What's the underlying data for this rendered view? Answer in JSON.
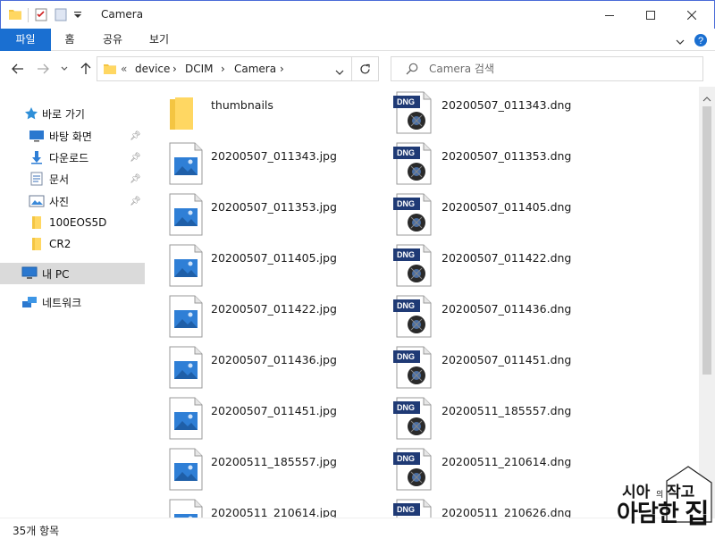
{
  "window": {
    "title": "Camera",
    "minimize_icon": "minimize-icon",
    "maximize_icon": "maximize-icon",
    "close_icon": "close-icon"
  },
  "ribbon": {
    "tabs": [
      {
        "label": "파일",
        "active": true
      },
      {
        "label": "홈"
      },
      {
        "label": "공유"
      },
      {
        "label": "보기"
      }
    ],
    "accent_color": "#1a6fd1"
  },
  "address": {
    "overflow": "«",
    "crumbs": [
      "device",
      "DCIM",
      "Camera"
    ]
  },
  "search": {
    "placeholder": "Camera 검색"
  },
  "sidebar": {
    "quick_access": "바로 가기",
    "items": [
      {
        "label": "바탕 화면",
        "icon": "desktop-icon",
        "pinned": true
      },
      {
        "label": "다운로드",
        "icon": "download-icon",
        "pinned": true
      },
      {
        "label": "문서",
        "icon": "document-icon",
        "pinned": true
      },
      {
        "label": "사진",
        "icon": "pictures-icon",
        "pinned": true
      },
      {
        "label": "100EOS5D",
        "icon": "folder-icon",
        "pinned": false
      },
      {
        "label": "CR2",
        "icon": "folder-icon",
        "pinned": false
      }
    ],
    "this_pc": "내 PC",
    "network": "네트워크"
  },
  "files": {
    "left": [
      {
        "name": "thumbnails",
        "type": "folder"
      },
      {
        "name": "20200507_011343.jpg",
        "type": "jpg"
      },
      {
        "name": "20200507_011353.jpg",
        "type": "jpg"
      },
      {
        "name": "20200507_011405.jpg",
        "type": "jpg"
      },
      {
        "name": "20200507_011422.jpg",
        "type": "jpg"
      },
      {
        "name": "20200507_011436.jpg",
        "type": "jpg"
      },
      {
        "name": "20200507_011451.jpg",
        "type": "jpg"
      },
      {
        "name": "20200511_185557.jpg",
        "type": "jpg"
      },
      {
        "name": "20200511_210614.jpg",
        "type": "jpg"
      }
    ],
    "right": [
      {
        "name": "20200507_011343.dng",
        "type": "dng"
      },
      {
        "name": "20200507_011353.dng",
        "type": "dng"
      },
      {
        "name": "20200507_011405.dng",
        "type": "dng"
      },
      {
        "name": "20200507_011422.dng",
        "type": "dng"
      },
      {
        "name": "20200507_011436.dng",
        "type": "dng"
      },
      {
        "name": "20200507_011451.dng",
        "type": "dng"
      },
      {
        "name": "20200511_185557.dng",
        "type": "dng"
      },
      {
        "name": "20200511_210614.dng",
        "type": "dng"
      },
      {
        "name": "20200511_210626.dng",
        "type": "dng"
      }
    ],
    "dng_badge": "DNG"
  },
  "status": {
    "count": "35개 항목"
  },
  "watermark": {
    "line1": "시아",
    "small1": "의",
    "line1b": "작고",
    "line2": "아담한",
    "line2b": "집"
  }
}
